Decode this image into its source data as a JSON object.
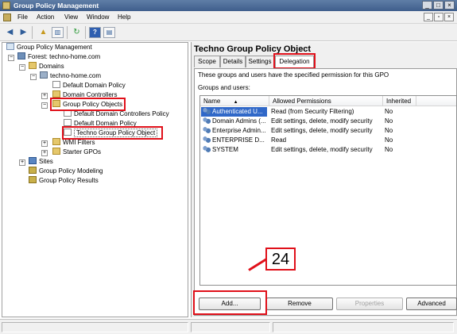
{
  "window": {
    "title": "Group Policy Management"
  },
  "menu": [
    "File",
    "Action",
    "View",
    "Window",
    "Help"
  ],
  "toolbar_icons": [
    "back-icon",
    "forward-icon",
    "up-folder-icon",
    "show-hide-tree-icon",
    "refresh-icon",
    "help-icon",
    "properties-icon"
  ],
  "tree": {
    "root": "Group Policy Management",
    "forest": "Forest: techno-home.com",
    "domains": "Domains",
    "domain": "techno-home.com",
    "ddp": "Default Domain Policy",
    "dc": "Domain Controllers",
    "gpo_folder": "Group Policy Objects",
    "ddcp": "Default Domain Controllers Policy",
    "ddp2": "Default Domain Policy",
    "tgpo": "Techno Group Policy Object",
    "wmi": "WMI Filters",
    "starter": "Starter GPOs",
    "sites": "Sites",
    "modeling": "Group Policy Modeling",
    "results": "Group Policy Results"
  },
  "gpo": {
    "title": "Techno Group Policy Object",
    "tabs": [
      "Scope",
      "Details",
      "Settings",
      "Delegation"
    ],
    "active_tab": "Delegation",
    "description": "These groups and users have the specified permission for this GPO",
    "groups_label": "Groups and users:",
    "columns": [
      "Name",
      "Allowed Permissions",
      "Inherited"
    ],
    "rows": [
      {
        "name": "Authenticated U...",
        "perm": "Read (from Security Filtering)",
        "inherited": "No"
      },
      {
        "name": "Domain Admins (...",
        "perm": "Edit settings, delete, modify security",
        "inherited": "No"
      },
      {
        "name": "Enterprise Admin...",
        "perm": "Edit settings, delete, modify security",
        "inherited": "No"
      },
      {
        "name": "ENTERPRISE D...",
        "perm": "Read",
        "inherited": "No"
      },
      {
        "name": "SYSTEM",
        "perm": "Edit settings, delete, modify security",
        "inherited": "No"
      }
    ],
    "buttons": {
      "add": "Add...",
      "remove": "Remove",
      "properties": "Properties",
      "advanced": "Advanced"
    }
  },
  "annotation": {
    "step": "24"
  },
  "colors": {
    "highlight": "#e0101a",
    "selection": "#3068c8"
  }
}
